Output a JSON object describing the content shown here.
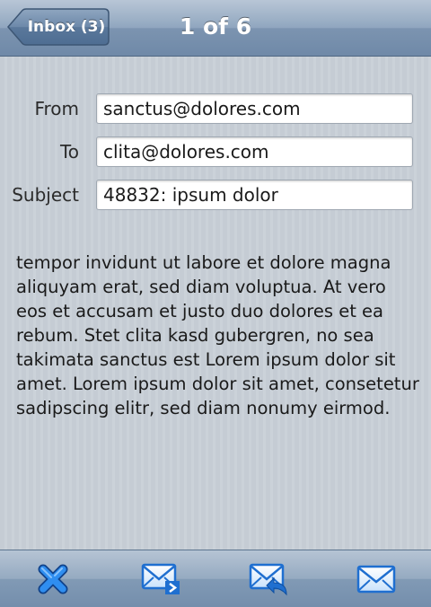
{
  "navbar": {
    "back_label": "Inbox (3)",
    "title": "1 of 6"
  },
  "message": {
    "from_label": "From",
    "from_value": "sanctus@dolores.com",
    "to_label": "To",
    "to_value": "clita@dolores.com",
    "subject_label": "Subject",
    "subject_value": "48832: ipsum dolor",
    "body": "tempor invidunt ut labore et dolore magna aliquyam erat, sed diam voluptua. At vero eos et accusam et justo duo dolores et ea rebum. Stet clita kasd gubergren, no sea takimata sanctus est Lorem ipsum dolor sit amet. Lorem ipsum dolor sit amet, consetetur sadipscing elitr, sed diam nonumy eirmod."
  },
  "toolbar": {
    "icons": [
      "delete-icon",
      "forward-icon",
      "reply-icon",
      "compose-icon"
    ]
  },
  "colors": {
    "accent_blue": "#1f7fe0",
    "navbar_blue": "#7c94b0"
  }
}
